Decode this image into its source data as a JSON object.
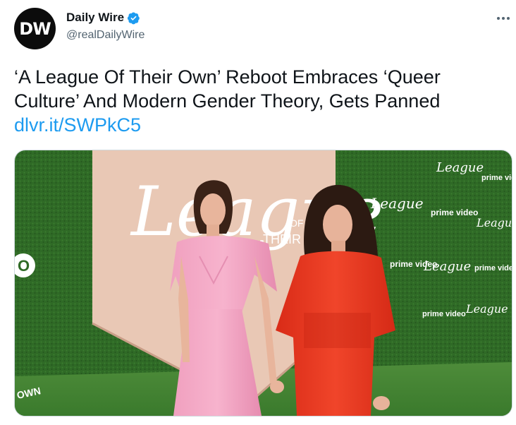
{
  "tweet": {
    "avatar_text": "DW",
    "display_name": "Daily Wire",
    "handle": "@realDailyWire",
    "text": "‘A League Of Their Own’ Reboot Embraces ‘Queer Culture’ And Modern Gender Theory, Gets Panned",
    "link": "dlvr.it/SWPkC5",
    "more_icon": "more-horizontal-icon",
    "verified_icon": "verified-badge-icon"
  },
  "media": {
    "backdrop_logo": "League",
    "backdrop_of": "OF",
    "backdrop_their": "THEIR O",
    "left_edge_letter": "O",
    "bottom_left_text": "OWN",
    "wall_brand_1": "League",
    "wall_brand_2": "prime video",
    "colors": {
      "grass": "#2f6a26",
      "panel": "#e9c8b5",
      "pink_dress": "#f4a3c2",
      "red_dress": "#e9351f"
    }
  }
}
